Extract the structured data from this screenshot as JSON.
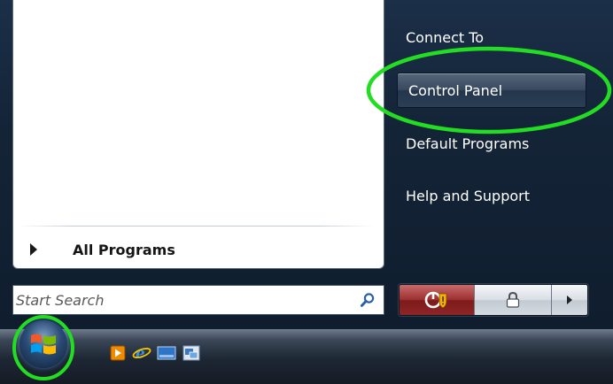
{
  "start_menu": {
    "all_programs": "All Programs",
    "search": {
      "placeholder": "Start Search"
    },
    "right_pane": {
      "items": [
        {
          "label": "Connect To"
        },
        {
          "label": "Control Panel",
          "highlighted": true
        },
        {
          "label": "Default Programs"
        },
        {
          "label": "Help and Support"
        }
      ]
    },
    "power_buttons": {
      "power_icon": "power-shield-icon",
      "lock_icon": "lock-icon",
      "options_icon": "chevron-right-icon"
    }
  },
  "taskbar": {
    "start_orb_icon": "windows-logo-icon",
    "quick_launch": [
      "media-player-icon",
      "internet-explorer-icon",
      "show-desktop-icon",
      "switch-windows-icon"
    ]
  },
  "annotations": {
    "highlight_color": "#22dd22"
  },
  "colors": {
    "menu_background": "#1b2f48",
    "taskbar": "#1d2733",
    "power_red": "#9c2f2f"
  }
}
